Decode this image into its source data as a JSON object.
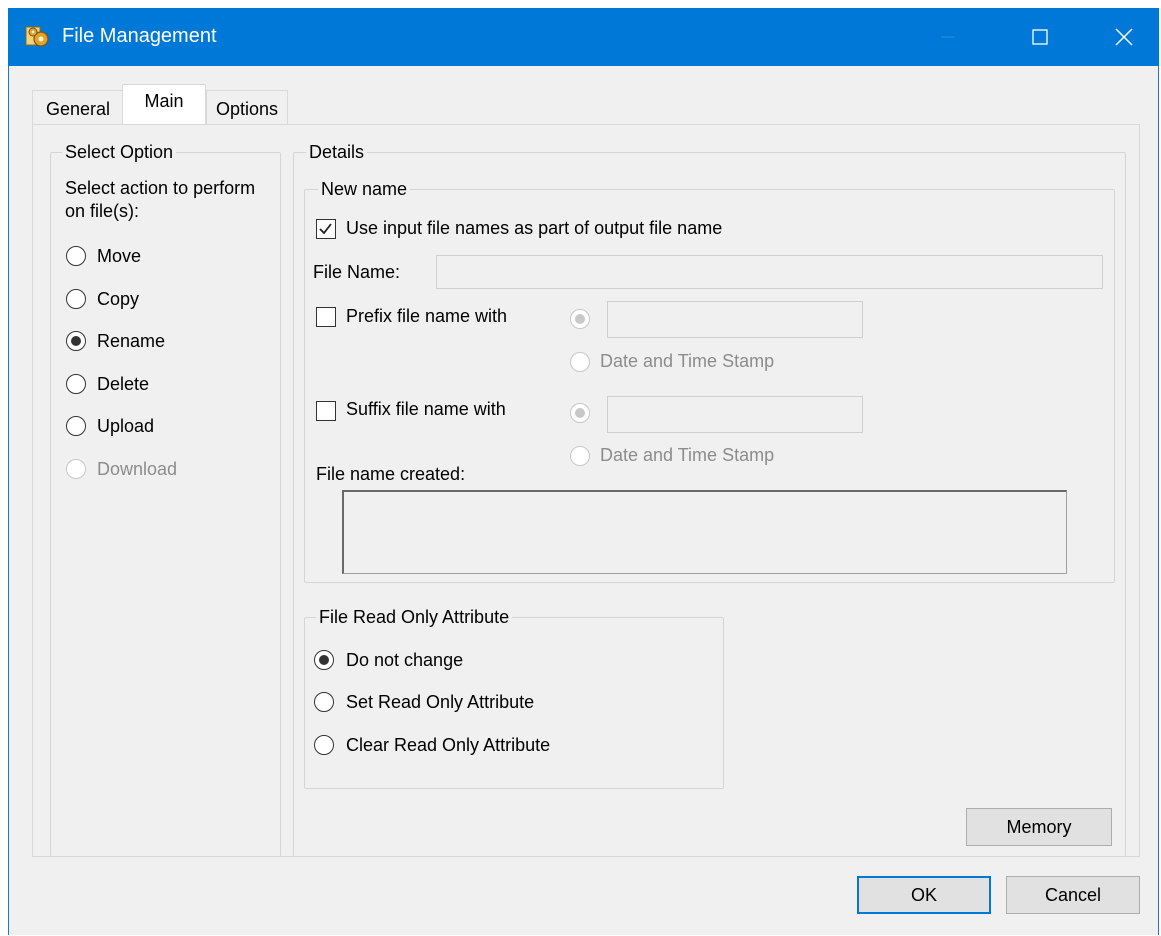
{
  "window": {
    "title": "File Management"
  },
  "tabs": [
    {
      "label": "General"
    },
    {
      "label": "Main"
    },
    {
      "label": "Options"
    }
  ],
  "select_option": {
    "title": "Select Option",
    "prompt": "Select action to perform on file(s):",
    "options": [
      {
        "label": "Move",
        "checked": false,
        "enabled": true
      },
      {
        "label": "Copy",
        "checked": false,
        "enabled": true
      },
      {
        "label": "Rename",
        "checked": true,
        "enabled": true
      },
      {
        "label": "Delete",
        "checked": false,
        "enabled": true
      },
      {
        "label": "Upload",
        "checked": false,
        "enabled": true
      },
      {
        "label": "Download",
        "checked": false,
        "enabled": false
      }
    ]
  },
  "details": {
    "title": "Details",
    "new_name": {
      "title": "New name",
      "use_input_names_label": "Use input file names as part of output file name",
      "use_input_names_checked": true,
      "file_name_label": "File Name:",
      "file_name_value": "",
      "prefix_label": "Prefix file name with",
      "prefix_checked": false,
      "prefix_text_value": "",
      "prefix_datetime_label": "Date and Time Stamp",
      "suffix_label": "Suffix file name with",
      "suffix_checked": false,
      "suffix_text_value": "",
      "suffix_datetime_label": "Date and Time Stamp",
      "created_label": "File name created:",
      "created_value": ""
    },
    "read_only": {
      "title": "File Read Only Attribute",
      "options": [
        {
          "label": "Do not change",
          "checked": true
        },
        {
          "label": "Set Read Only Attribute",
          "checked": false
        },
        {
          "label": "Clear Read Only Attribute",
          "checked": false
        }
      ]
    },
    "memory_button": "Memory"
  },
  "footer": {
    "ok_label": "OK",
    "cancel_label": "Cancel"
  },
  "colors": {
    "titlebar": "#0078d7",
    "dialog_bg": "#f0f0f0",
    "default_button_border": "#0078d7"
  }
}
